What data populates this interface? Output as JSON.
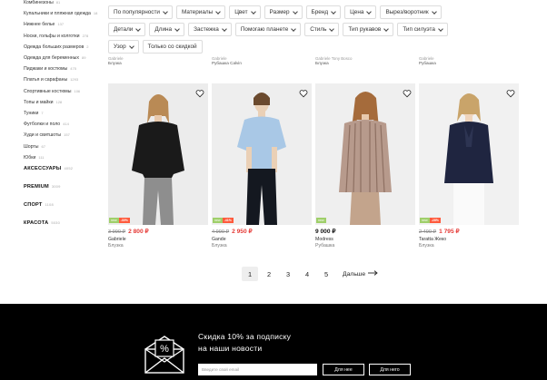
{
  "sidebar": {
    "items": [
      {
        "label": "Комбинезоны",
        "count": "81"
      },
      {
        "label": "Купальники и пляжная одежда",
        "count": "18"
      },
      {
        "label": "Нижнее белье",
        "count": "137"
      },
      {
        "label": "Носки, гольфы и колготки",
        "count": "278"
      },
      {
        "label": "Одежда больших размеров",
        "count": "2"
      },
      {
        "label": "Одежда для беременных",
        "count": "89"
      },
      {
        "label": "Пиджаки и костюмы",
        "count": "475"
      },
      {
        "label": "Платья и сарафаны",
        "count": "1293"
      },
      {
        "label": "Спортивные костюмы",
        "count": "106"
      },
      {
        "label": "Топы и майки",
        "count": "128"
      },
      {
        "label": "Туники",
        "count": "7"
      },
      {
        "label": "Футболки и поло",
        "count": "414"
      },
      {
        "label": "Худи и свитшоты",
        "count": "157"
      },
      {
        "label": "Шорты",
        "count": "67"
      },
      {
        "label": "Юбки",
        "count": "111"
      }
    ],
    "sections": [
      {
        "label": "АКСЕССУАРЫ",
        "count": "4052"
      },
      {
        "label": "PREMIUM",
        "count": "3009"
      },
      {
        "label": "СПОРТ",
        "count": "1108"
      },
      {
        "label": "КРАСОТА",
        "count": "5030"
      }
    ]
  },
  "filters": {
    "row1": [
      "По популярности",
      "Материалы",
      "Цвет",
      "Размер",
      "Бренд",
      "Цена",
      "Вырез/воротник"
    ],
    "row2": [
      "Детали",
      "Длина",
      "Застежка",
      "Помогаю планете",
      "Стиль",
      "Тип рукавов",
      "Тип силуэта"
    ],
    "row3": [
      "Узор"
    ],
    "discount_label": "Только со скидкой"
  },
  "prev_row": [
    {
      "l1": "Gabriele",
      "l2": "Блузка"
    },
    {
      "l1": "Gabriele",
      "l2": "Рубашка Calvin"
    },
    {
      "l1": "Gabriele Tony Bosco",
      "l2": "Блузка"
    },
    {
      "l1": "Gabriele",
      "l2": "Рубашка"
    }
  ],
  "products": [
    {
      "old_price": "3 990 ₽",
      "price": "2 800 ₽",
      "brand": "Gabriele",
      "type": "Блузка",
      "badge_green": "new",
      "badge_red": "-30%",
      "on_sale": true
    },
    {
      "old_price": "4 990 ₽",
      "price": "2 950 ₽",
      "brand": "Gande",
      "type": "Блузка",
      "badge_green": "new",
      "badge_red": "-41%",
      "on_sale": true
    },
    {
      "old_price": "",
      "price": "9 000 ₽",
      "brand": "Modress",
      "type": "Рубашка",
      "badge_green": "new",
      "badge_red": "",
      "on_sale": false
    },
    {
      "old_price": "2 490 ₽",
      "price": "1 795 ₽",
      "brand": "Taratta Жеко",
      "type": "Блузка",
      "badge_green": "new",
      "badge_red": "-28%",
      "on_sale": true
    }
  ],
  "pagination": {
    "pages": [
      "1",
      "2",
      "3",
      "4",
      "5"
    ],
    "active": "1",
    "next_label": "Дальше"
  },
  "footer": {
    "promo_line1": "Скидка 10% за подписку",
    "promo_line2": "на наши новости",
    "email_placeholder": "Введите свой email",
    "btn_women": "Для нее",
    "btn_men": "Для него"
  },
  "colors": {
    "sale_red": "#e53935",
    "badge_red": "#ff5a3c",
    "badge_green": "#9fcf6a",
    "footer_bg": "#000000"
  }
}
